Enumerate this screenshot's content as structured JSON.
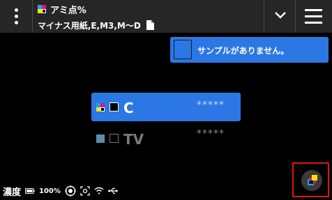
{
  "header": {
    "menu_icon": "kebab-icon",
    "title": "アミ点%",
    "subtitle": "マイナス用紙,E,M3,M〜D",
    "document_icon": "document-icon",
    "dropdown_icon": "chevron-down-icon",
    "hamburger_icon": "hamburger-icon"
  },
  "sample": {
    "message": "サンプルがありません。"
  },
  "channels": [
    {
      "label": "C",
      "stars": "*****",
      "selected": true
    },
    {
      "label": "TV",
      "stars": "*****",
      "selected": false
    }
  ],
  "status": {
    "density_label": "濃度",
    "battery": "100%",
    "icons": [
      "battery-icon",
      "target-icon",
      "focus-icon",
      "wifi-icon",
      "usb-icon"
    ]
  },
  "colors": {
    "accent": "#2b78e4",
    "header_bg": "#262626",
    "highlight": "#e0151b",
    "cyan": "#19a7e8",
    "magenta": "#e6127f",
    "yellow": "#ffe600",
    "tv_swatch": "#5e8ea6"
  }
}
